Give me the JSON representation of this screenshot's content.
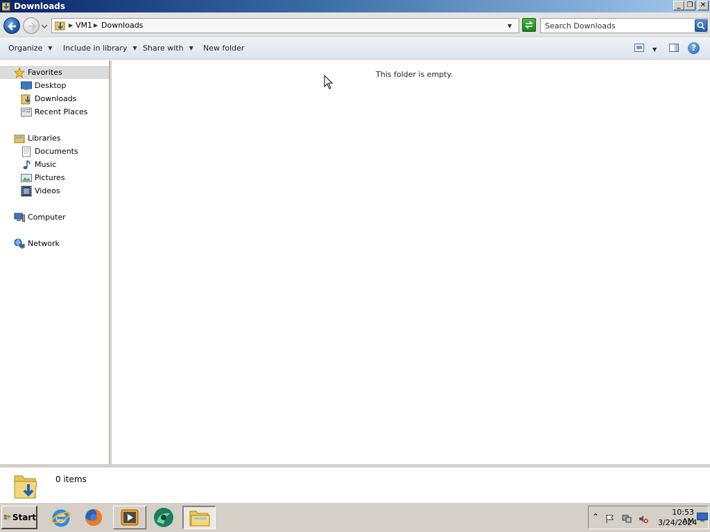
{
  "window": {
    "title": "Downloads",
    "icon": "folder-download-icon",
    "controls": [
      "minimize-icon",
      "restore-icon",
      "close-icon"
    ]
  },
  "address": {
    "crumbs": [
      "VM1",
      "Downloads"
    ],
    "search_placeholder": "Search Downloads"
  },
  "toolbar": {
    "organize": "Organize",
    "include_in_library": "Include in library",
    "share_with": "Share with",
    "new_folder": "New folder"
  },
  "nav": {
    "favorites": {
      "label": "Favorites",
      "items": [
        {
          "label": "Desktop",
          "icon": "desktop-icon"
        },
        {
          "label": "Downloads",
          "icon": "downloads-icon"
        },
        {
          "label": "Recent Places",
          "icon": "recent-places-icon"
        }
      ]
    },
    "libraries": {
      "label": "Libraries",
      "items": [
        {
          "label": "Documents",
          "icon": "documents-icon"
        },
        {
          "label": "Music",
          "icon": "music-icon"
        },
        {
          "label": "Pictures",
          "icon": "pictures-icon"
        },
        {
          "label": "Videos",
          "icon": "videos-icon"
        }
      ]
    },
    "computer": "Computer",
    "network": "Network"
  },
  "content": {
    "empty_message": "This folder is empty."
  },
  "details": {
    "item_count": "0 items"
  },
  "taskbar": {
    "start_label": "Start",
    "apps": [
      "internet-explorer-icon",
      "firefox-icon",
      "media-player-icon",
      "chrome-remote-icon",
      "explorer-icon"
    ],
    "clock_time": "10:53 AM",
    "clock_date": "3/24/2024"
  },
  "colors": {
    "title_gradient_start": "#0a246a",
    "title_gradient_end": "#a6caf0",
    "selected_nav": "#dcdcdc",
    "window_chrome": "#d4d0c8"
  }
}
